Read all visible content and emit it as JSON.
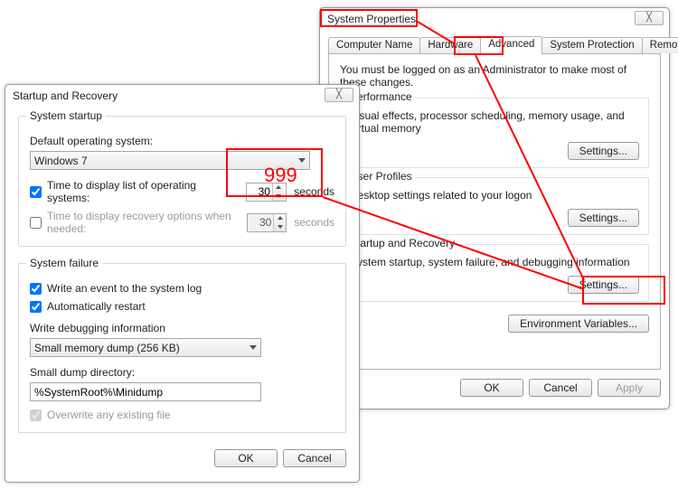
{
  "sysprops": {
    "title": "System Properties",
    "close_glyph": "╳",
    "tabs": {
      "computer_name": "Computer Name",
      "hardware": "Hardware",
      "advanced": "Advanced",
      "system_protection": "System Protection",
      "remote": "Remote"
    },
    "admin_note": "You must be logged on as an Administrator to make most of these changes.",
    "perf": {
      "title": "Performance",
      "desc": "Visual effects, processor scheduling, memory usage, and virtual memory",
      "button": "Settings..."
    },
    "profiles": {
      "title": "User Profiles",
      "desc": "Desktop settings related to your logon",
      "button": "Settings..."
    },
    "startup": {
      "title": "Startup and Recovery",
      "desc": "System startup, system failure, and debugging information",
      "button": "Settings..."
    },
    "env_button": "Environment Variables...",
    "ok": "OK",
    "cancel": "Cancel",
    "apply": "Apply"
  },
  "sr": {
    "title": "Startup and Recovery",
    "close_glyph": "╳",
    "startup_legend": "System startup",
    "default_os_label": "Default operating system:",
    "default_os_value": "Windows 7",
    "time_list_label": "Time to display list of operating systems:",
    "time_list_value": "30",
    "time_list_checked": true,
    "time_recovery_label": "Time to display recovery options when needed:",
    "time_recovery_value": "30",
    "time_recovery_checked": false,
    "seconds": "seconds",
    "failure_legend": "System failure",
    "write_event_label": "Write an event to the system log",
    "write_event_checked": true,
    "auto_restart_label": "Automatically restart",
    "auto_restart_checked": true,
    "debug_label": "Write debugging information",
    "debug_value": "Small memory dump (256 KB)",
    "dump_dir_label": "Small dump directory:",
    "dump_dir_value": "%SystemRoot%\\Minidump",
    "overwrite_label": "Overwrite any existing file",
    "overwrite_checked": true,
    "ok": "OK",
    "cancel": "Cancel"
  },
  "annotation": {
    "nine_nine_nine": "999"
  }
}
